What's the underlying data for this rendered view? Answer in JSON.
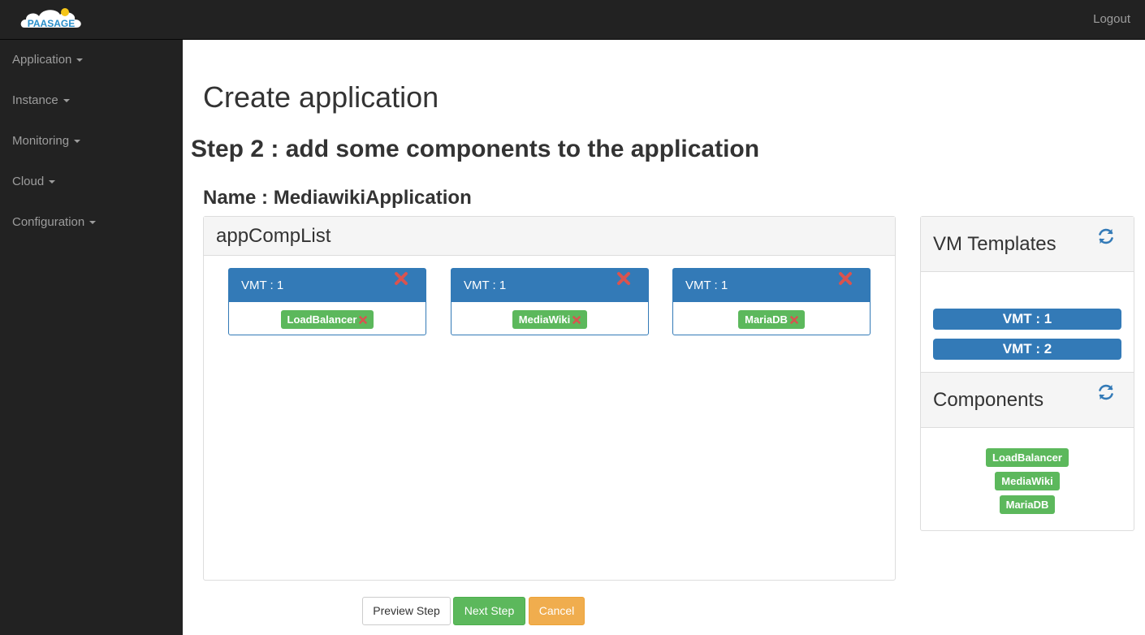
{
  "header": {
    "logo_text": "PAASAGE",
    "logout_label": "Logout"
  },
  "sidebar": {
    "items": [
      {
        "label": "Application"
      },
      {
        "label": "Instance"
      },
      {
        "label": "Monitoring"
      },
      {
        "label": "Cloud"
      },
      {
        "label": "Configuration"
      }
    ]
  },
  "main": {
    "page_title": "Create application",
    "step_title": "Step 2 : add some components to the application",
    "name_line": "Name : MediawikiApplication",
    "app_panel_title": "appCompList",
    "vm_cards": [
      {
        "title": "VMT : 1",
        "component": "LoadBalancer"
      },
      {
        "title": "VMT : 1",
        "component": "MediaWiki"
      },
      {
        "title": "VMT : 1",
        "component": "MariaDB"
      }
    ],
    "vm_templates": {
      "title": "VM Templates",
      "items": [
        "VMT : 1",
        "VMT : 2"
      ]
    },
    "components": {
      "title": "Components",
      "items": [
        "LoadBalancer",
        "MediaWiki",
        "MariaDB"
      ]
    },
    "buttons": {
      "preview": "Preview Step",
      "next": "Next Step",
      "cancel": "Cancel"
    }
  },
  "colors": {
    "primary": "#337ab7",
    "success": "#5cb85c",
    "warning": "#f0ad4e",
    "danger": "#d9534f",
    "navbar": "#222222"
  }
}
